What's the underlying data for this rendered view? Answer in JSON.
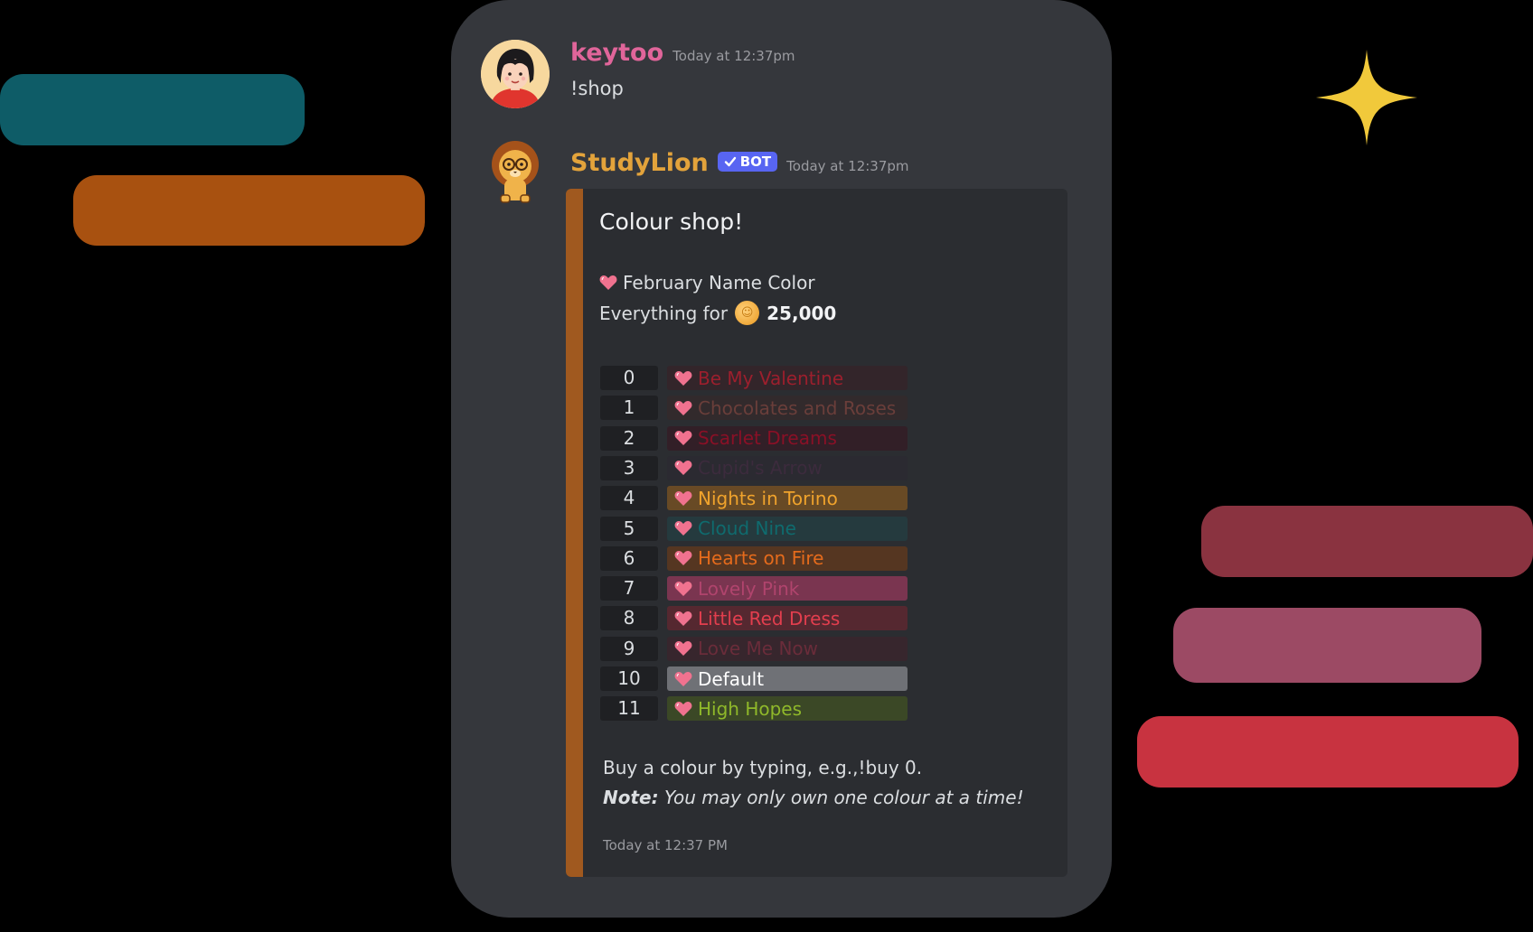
{
  "colors": {
    "deco_teal": "#0e5c67",
    "deco_orange": "#a85110",
    "deco_maroon": "#8a3340",
    "deco_mauve": "#9c4a64",
    "deco_red": "#c83340",
    "star": "#f1c93b",
    "phone_bg": "#35373c",
    "embed_bg": "#2b2d31",
    "embed_bar": "#a0591f"
  },
  "user_message": {
    "username": "keytoo",
    "username_color": "#e0659a",
    "timestamp": "Today at 12:37pm",
    "content": "!shop",
    "avatar_icon": "girl-avatar-icon"
  },
  "bot_message": {
    "username": "StudyLion",
    "username_color": "#e3a33b",
    "badge_label": "BOT",
    "timestamp": "Today at 12:37pm",
    "avatar_icon": "lion-avatar-icon",
    "embed": {
      "title": "Colour shop!",
      "subtitle": "February Name Color",
      "price_prefix": "Everything for",
      "price": "25,000",
      "items": [
        {
          "num": "0",
          "name": "Be My Valentine",
          "text_color": "#9c1f2d",
          "bg": "#33252a"
        },
        {
          "num": "1",
          "name": "Chocolates and Roses",
          "text_color": "#6a3e3a",
          "bg": "#322a2c"
        },
        {
          "num": "2",
          "name": "Scarlet Dreams",
          "text_color": "#8a1026",
          "bg": "#321f27"
        },
        {
          "num": "3",
          "name": "Cupid's Arrow",
          "text_color": "#3c2b3d",
          "bg": "#2b2a31"
        },
        {
          "num": "4",
          "name": "Nights in Torino",
          "text_color": "#f0a32c",
          "bg": "#684a25"
        },
        {
          "num": "5",
          "name": "Cloud Nine",
          "text_color": "#0f6b6e",
          "bg": "#253a3e"
        },
        {
          "num": "6",
          "name": "Hearts on Fire",
          "text_color": "#e56b1c",
          "bg": "#553621"
        },
        {
          "num": "7",
          "name": "Lovely Pink",
          "text_color": "#b0446d",
          "bg": "#7a3550"
        },
        {
          "num": "8",
          "name": "Little Red Dress",
          "text_color": "#e23e4e",
          "bg": "#552830"
        },
        {
          "num": "9",
          "name": "Love Me Now",
          "text_color": "#6a2c3a",
          "bg": "#37262d"
        },
        {
          "num": "10",
          "name": "Default",
          "text_color": "#ffffff",
          "bg": "#6f7176"
        },
        {
          "num": "11",
          "name": "High Hopes",
          "text_color": "#8fb82a",
          "bg": "#3b4826"
        }
      ],
      "instructions": "Buy a colour by typing, e.g.,!buy 0.",
      "note_label": "Note:",
      "note_text": "You may only own one colour at a time!",
      "footer_timestamp": "Today at 12:37 PM"
    }
  }
}
